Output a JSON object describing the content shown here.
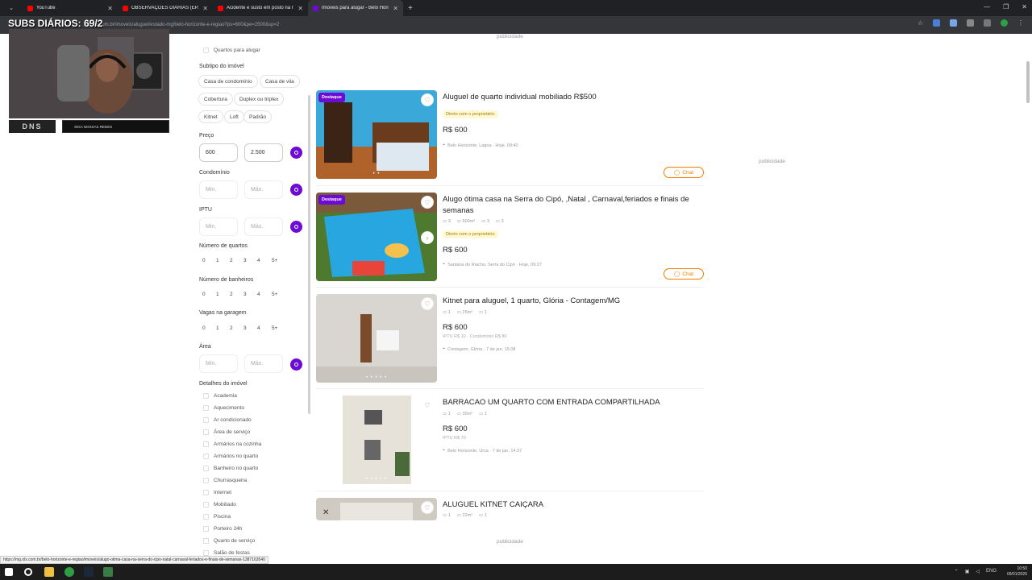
{
  "browser": {
    "tabs": [
      {
        "label": "YouTube",
        "fav": "#ff0000"
      },
      {
        "label": "OBSERVAÇÕES DIÁRIAS (EP. 30",
        "fav": "#ff0000"
      },
      {
        "label": "Acidente e susto em posto na r",
        "fav": "#ff0000"
      },
      {
        "label": "Imóveis para alugar - Belo Hori",
        "fav": "#6e0ad6",
        "active": true
      }
    ],
    "url": "mg.olx.com.br/imoveis/aluguel/estado-mg/belo-horizonte-e-regiao?ps=600&pe=2500&sp=2"
  },
  "overlay": {
    "subs": "SUBS DIÁRIOS: 69/2",
    "brand": "DNS",
    "brand2": "SIGA NOSSAS REDES"
  },
  "sidebar": {
    "quartos_para_alugar": "Quartos para alugar",
    "subtipo_title": "Subtipo do imóvel",
    "subtipos": [
      "Casa de condomínio",
      "Casa de vila",
      "Cobertura",
      "Duplex ou triplex",
      "Kitnet",
      "Loft",
      "Padrão"
    ],
    "preco_title": "Preço",
    "preco_min": "600",
    "preco_max": "2.500",
    "condominio_title": "Condomínio",
    "iptu_title": "IPTU",
    "area_title": "Área",
    "min_ph": "Min.",
    "max_ph": "Máx.",
    "quartos_title": "Número de quartos",
    "banheiros_title": "Número de banheiros",
    "vagas_title": "Vagas na garagem",
    "numeros": [
      "0",
      "1",
      "2",
      "3",
      "4",
      "5+"
    ],
    "detalhes_title": "Detalhes do imóvel",
    "detalhes": [
      "Academia",
      "Aquecimento",
      "Ar condicionado",
      "Área de serviço",
      "Armários na cozinha",
      "Armários no quarto",
      "Banheiro no quarto",
      "Churrasqueira",
      "Internet",
      "Mobiliado",
      "Piscina",
      "Porteiro 24h",
      "Quarto de serviço",
      "Salão de festas"
    ]
  },
  "publicidade": "publicidade",
  "listings": [
    {
      "badge": "Destaque",
      "title": "Aluguel de quarto individual mobiliado R$500",
      "tag": "Direto com o proprietário",
      "price": "R$ 600",
      "loc": "Belo Horizonte, Lagoa · Hoje, 09:40",
      "chat": "Chat"
    },
    {
      "badge": "Destaque",
      "title": "Alugo ótima casa na Serra do Cipó, ,Natal , Carnaval,feriados e finais de semanas",
      "feats": [
        "3",
        "600m²",
        "3",
        "3"
      ],
      "tag": "Direto com o proprietário",
      "price": "R$ 600",
      "loc": "Santana do Riacho, Serra do Cipó · Hoje, 09:27",
      "chat": "Chat"
    },
    {
      "title": "Kitnet para aluguel, 1 quarto, Glória - Contagem/MG",
      "feats": [
        "1",
        "25m²",
        "1"
      ],
      "price": "R$ 600",
      "sub": "IPTU R$ 10 · Condomínio R$ 80",
      "loc": "Contagem, Glória · 7 de jan, 15:08"
    },
    {
      "title": "BARRACAO UM QUARTO COM ENTRADA COMPARTILHADA",
      "feats": [
        "1",
        "30m²",
        "1"
      ],
      "price": "R$ 600",
      "sub": "IPTU R$ 70",
      "loc": "Belo Horizonte, Urca · 7 de jan, 14:37"
    },
    {
      "title": "ALUGUEL KITNET CAIÇARA",
      "feats": [
        "1",
        "22m²",
        "1"
      ]
    }
  ],
  "status_url": "https://mg.olx.com.br/belo-horizonte-e-regiao/imoveis/alugo-otima-casa-na-serra-do-cipo-natal-carnaval-feriados-e-finais-de-semanas-1387163540",
  "tray": {
    "lang": "ENG",
    "time": "10:50",
    "date": "09/01/2026"
  }
}
